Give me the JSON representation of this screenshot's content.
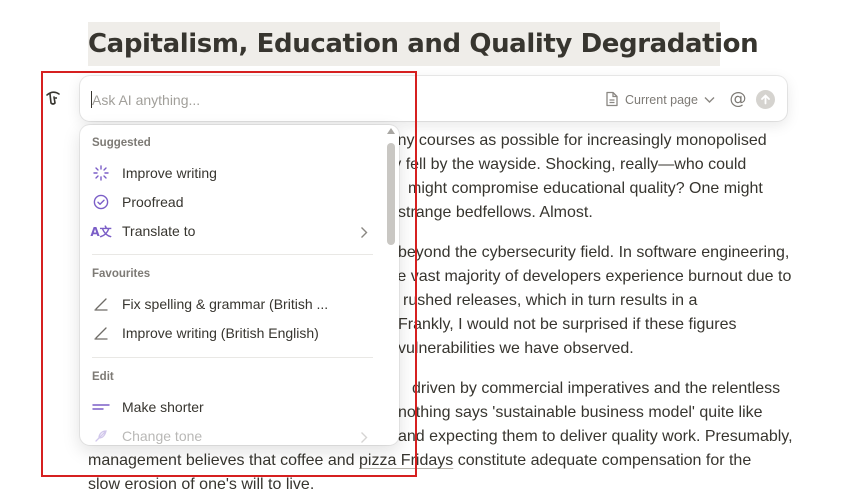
{
  "page": {
    "title": "Capitalism, Education and Quality Degradation",
    "lines": [
      {
        "id": "l1a",
        "text": "as many courses as possible for increasingly monopolised"
      },
      {
        "id": "l1b",
        "text": "quality fell by the wayside. Shocking, really—who could"
      },
      {
        "id": "l1c",
        "text": "might compromise educational quality? One might"
      },
      {
        "id": "l1d",
        "text": "strange bedfellows. Almost."
      },
      {
        "id": "l2a",
        "text": "beyond the cybersecurity field. In software engineering,"
      },
      {
        "id": "l2b",
        "text": "the vast majority of developers experience burnout due to"
      },
      {
        "id": "l2c",
        "text": "rushed releases, which in turn results in a"
      },
      {
        "id": "l2d",
        "text": "Frankly, I would not be surprised if these figures"
      },
      {
        "id": "l2e",
        "text": "vulnerabilities we have observed."
      },
      {
        "id": "l3a",
        "text": "driven by commercial imperatives and the relentless"
      },
      {
        "id": "l3b",
        "text": "nothing says 'sustainable business model' quite like"
      },
      {
        "id": "l3c",
        "text": "and expecting them to deliver quality work. Presumably,"
      },
      {
        "id": "l3d_pre",
        "text": "management believes that coffee and "
      },
      {
        "id": "l3d_link",
        "text": "pizza Fridays"
      },
      {
        "id": "l3d_post",
        "text": " constitute adequate compensation for the"
      },
      {
        "id": "l3e",
        "text": "slow erosion of one's will to live."
      }
    ]
  },
  "ai_bar": {
    "placeholder": "Ask AI anything...",
    "context_label": "Current page",
    "context_icon": "page-icon",
    "mention_symbol": "@",
    "send_icon": "arrow-up-icon"
  },
  "menu": {
    "sections": [
      {
        "label": "Suggested",
        "items": [
          {
            "label": "Improve writing",
            "icon": "sparkle-icon"
          },
          {
            "label": "Proofread",
            "icon": "check-circle-icon"
          },
          {
            "label": "Translate to",
            "icon": "translate-icon",
            "has_submenu": true
          }
        ]
      },
      {
        "label": "Favourites",
        "items": [
          {
            "label": "Fix spelling & grammar (British ...",
            "icon": "pen-icon"
          },
          {
            "label": "Improve writing (British English)",
            "icon": "pen-icon"
          }
        ]
      },
      {
        "label": "Edit",
        "items": [
          {
            "label": "Make shorter",
            "icon": "lines-icon"
          },
          {
            "label": "Change tone",
            "icon": "feather-icon",
            "has_submenu": true
          }
        ]
      }
    ]
  },
  "colors": {
    "accent_purple": "#7b5ec7",
    "highlight_red": "#d62020",
    "title_bg": "#efede9"
  }
}
